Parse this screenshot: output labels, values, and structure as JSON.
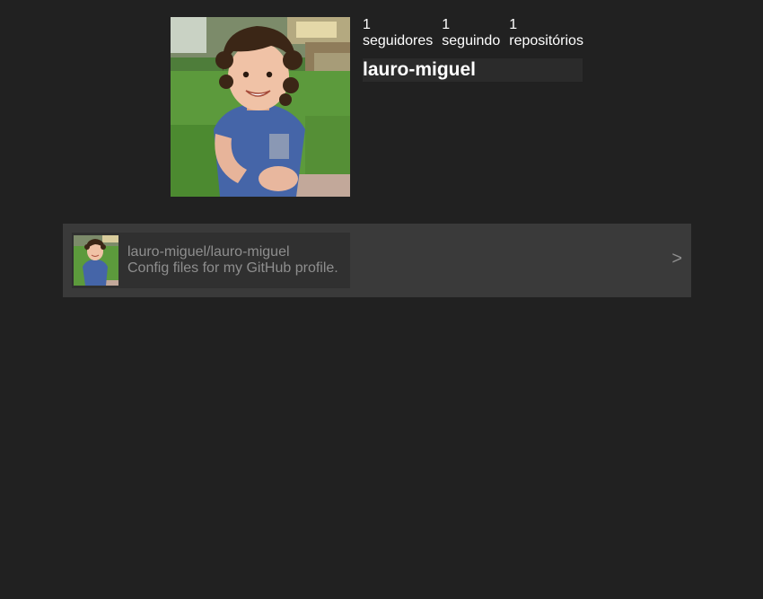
{
  "profile": {
    "username": "lauro-miguel",
    "stats": [
      {
        "count": "1",
        "label": "seguidores"
      },
      {
        "count": "1",
        "label": "seguindo"
      },
      {
        "count": "1",
        "label": "repositórios"
      }
    ]
  },
  "repos": {
    "items": [
      {
        "name": "lauro-miguel/lauro-miguel",
        "description": "Config files for my GitHub profile."
      }
    ],
    "next_label": ">"
  },
  "colors": {
    "background": "#212121",
    "panel": "#3a3a3a",
    "card": "#303030",
    "text_primary": "#ffffff",
    "text_muted": "#8e8e8e"
  }
}
